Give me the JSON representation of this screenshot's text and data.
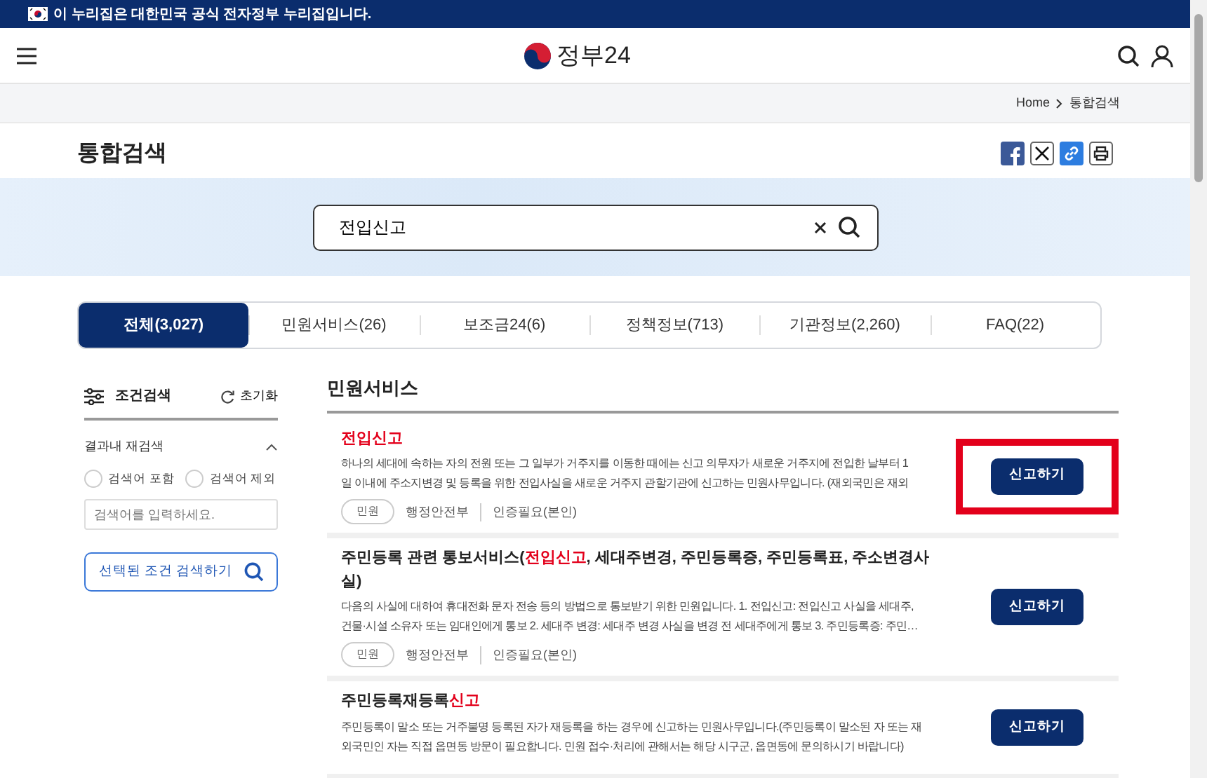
{
  "gov_banner": {
    "text": "이 누리집은 대한민국 공식 전자정부 누리집입니다."
  },
  "header": {
    "logo_text": "정부24"
  },
  "breadcrumb": [
    "Home",
    "통합검색"
  ],
  "page_title": "통합검색",
  "search": {
    "value": "전입신고"
  },
  "tabs": [
    {
      "label": "전체(3,027)",
      "selected": true
    },
    {
      "label": "민원서비스(26)",
      "selected": false
    },
    {
      "label": "보조금24(6)",
      "selected": false
    },
    {
      "label": "정책정보(713)",
      "selected": false
    },
    {
      "label": "기관정보(2,260)",
      "selected": false
    },
    {
      "label": "FAQ(22)",
      "selected": false
    }
  ],
  "filter": {
    "title": "조건검색",
    "reset": "초기화",
    "section": "결과내 재검색",
    "expanded": true,
    "options": [
      {
        "label": "검색어 포함",
        "selected": false
      },
      {
        "label": "검색어 제외",
        "selected": false
      }
    ],
    "placeholder": "검색어를 입력하세요.",
    "submit": "선택된 조건 검색하기"
  },
  "results_heading": "민원서비스",
  "results": [
    {
      "title": [
        {
          "text": "전입신고",
          "hit": true
        }
      ],
      "lines": [
        "하나의 세대에 속하는 자의 전원 또는 그 일부가 거주지를 이동한 때에는 신고 의무자가 새로운 거주지에 전입한 날부터 1",
        "일 이내에 주소지변경 및 등록을 위한 전입사실을 새로운 거주지 관할기관에 신고하는 민원사무입니다. (재외국민은 재외"
      ],
      "tag": "민원",
      "agency": "행정안전부",
      "auth": "인증필요(본인)",
      "button": "신고하기",
      "highlighted": true
    },
    {
      "title": [
        {
          "text": "주민등록 관련 통보서비스(",
          "hit": false
        },
        {
          "text": "전입신고",
          "hit": true
        },
        {
          "text": ", 세대주변경, 주민등록증, 주민등록표, 주소변경사실)",
          "hit": false
        }
      ],
      "lines": [
        "다음의 사실에 대하여 휴대전화 문자 전송 등의 방법으로 통보받기 위한 민원입니다. 1. 전입신고: 전입신고 사실을 세대주,",
        "건물·시설 소유자 또는 임대인에게 통보 2. 세대주 변경: 세대주 변경 사실을 변경 전 세대주에게 통보 3. 주민등록증: 주민…"
      ],
      "tag": "민원",
      "agency": "행정안전부",
      "auth": "인증필요(본인)",
      "button": "신고하기",
      "highlighted": false
    },
    {
      "title": [
        {
          "text": "주민등록재등록",
          "hit": false
        },
        {
          "text": "신고",
          "hit": true
        }
      ],
      "lines": [
        "주민등록이 말소 또는 거주불명 등록된 자가 재등록을 하는 경우에 신고하는 민원사무입니다.(주민등록이 말소된 자 또는 재",
        "외국민인 자는 직접 읍면동 방문이 필요합니다. 민원 접수·처리에 관해서는 해당 시구군, 읍면동에 문의하시기 바랍니다)"
      ],
      "button": "신고하기",
      "highlighted": false
    }
  ]
}
